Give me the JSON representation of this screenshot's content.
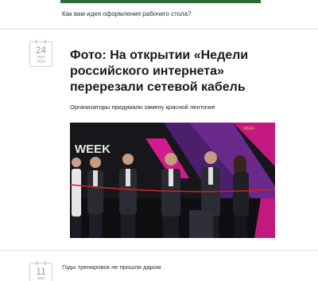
{
  "previous_article": {
    "caption": "Как вам идея оформления рабочего стола?"
  },
  "article": {
    "date": {
      "day": "24",
      "month": "мая",
      "year": "2018"
    },
    "title": "Фото: На открытии «Недели российского интернета» перерезали сетевой кабель",
    "subtitle": "Организаторы придумали замену красной ленточке",
    "photo_banner_text": "WEEK",
    "photo_corner_text": "WEEK"
  },
  "next_article": {
    "date": {
      "day": "11",
      "month": "мая"
    },
    "title": "Годы тренировок не прошли даром"
  },
  "colors": {
    "accent_magenta": "#d21b8f",
    "banner_purple": "#4b1f6b",
    "cable_red": "#d32020",
    "badge_border": "#cfcfcf",
    "divider": "#e2e2e2"
  }
}
